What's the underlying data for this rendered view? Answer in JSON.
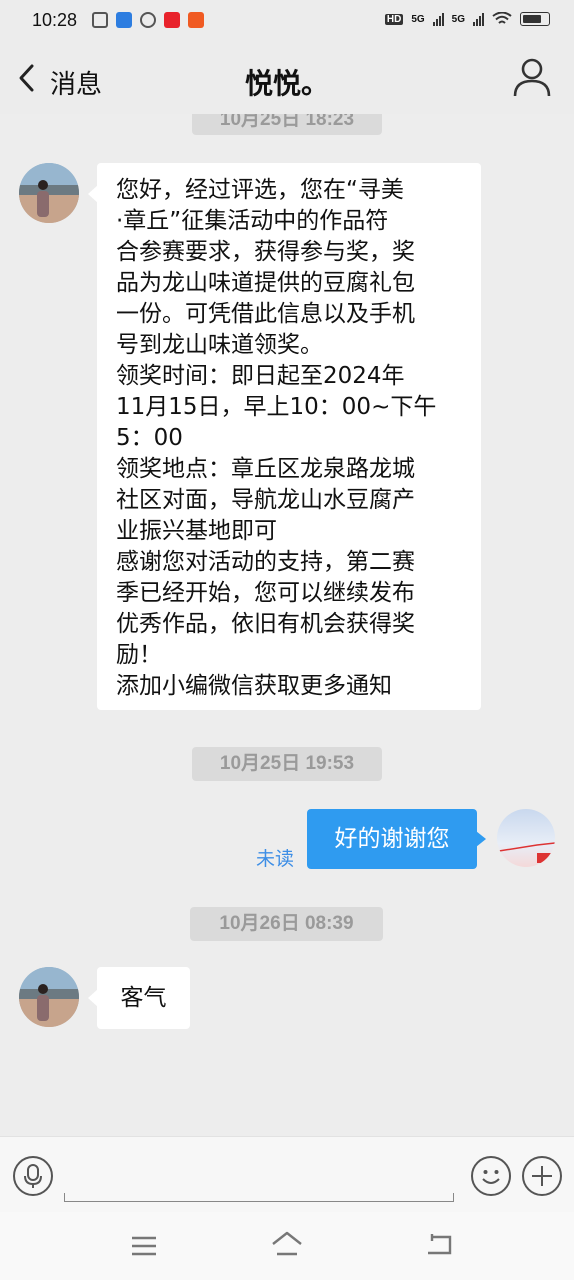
{
  "status_bar": {
    "time": "10:28",
    "hd_label": "HD",
    "net1": "5G",
    "net2": "5G"
  },
  "header": {
    "back_label": "消息",
    "title": "悦悦。"
  },
  "messages": [
    {
      "type": "timestamp",
      "text": "10月25日 18:23"
    },
    {
      "type": "incoming",
      "lines": [
        "您好，经过评选，您在“寻美",
        "·章丘”征集活动中的作品符",
        "合参赛要求，获得参与奖，奖",
        "品为龙山味道提供的豆腐礼包",
        "一份。可凭借此信息以及手机",
        "号到龙山味道领奖。",
        "领奖时间：即日起至2024年",
        "11月15日，早上10：00~下午",
        "5：00",
        "领奖地点：章丘区龙泉路龙城",
        "社区对面，导航龙山水豆腐产",
        "业振兴基地即可",
        "感谢您对活动的支持，第二赛",
        "季已经开始，您可以继续发布",
        "优秀作品，依旧有机会获得奖",
        "励！",
        "添加小编微信获取更多通知"
      ]
    },
    {
      "type": "timestamp",
      "text": "10月25日 19:53"
    },
    {
      "type": "outgoing",
      "text": "好的谢谢您",
      "status": "未读"
    },
    {
      "type": "timestamp",
      "text": "10月26日 08:39"
    },
    {
      "type": "incoming",
      "text": "客气"
    }
  ],
  "colors": {
    "background": "#ededed",
    "outgoing_bubble": "#2f9bf0",
    "unread_text": "#3d8ee6",
    "timestamp_bg": "#dadada"
  },
  "icons": {
    "back": "chevron-left-icon",
    "profile": "person-icon",
    "voice": "microphone-icon",
    "emoji": "smiley-icon",
    "more": "plus-icon",
    "menu": "menu-icon",
    "home": "home-icon",
    "return": "return-icon"
  }
}
